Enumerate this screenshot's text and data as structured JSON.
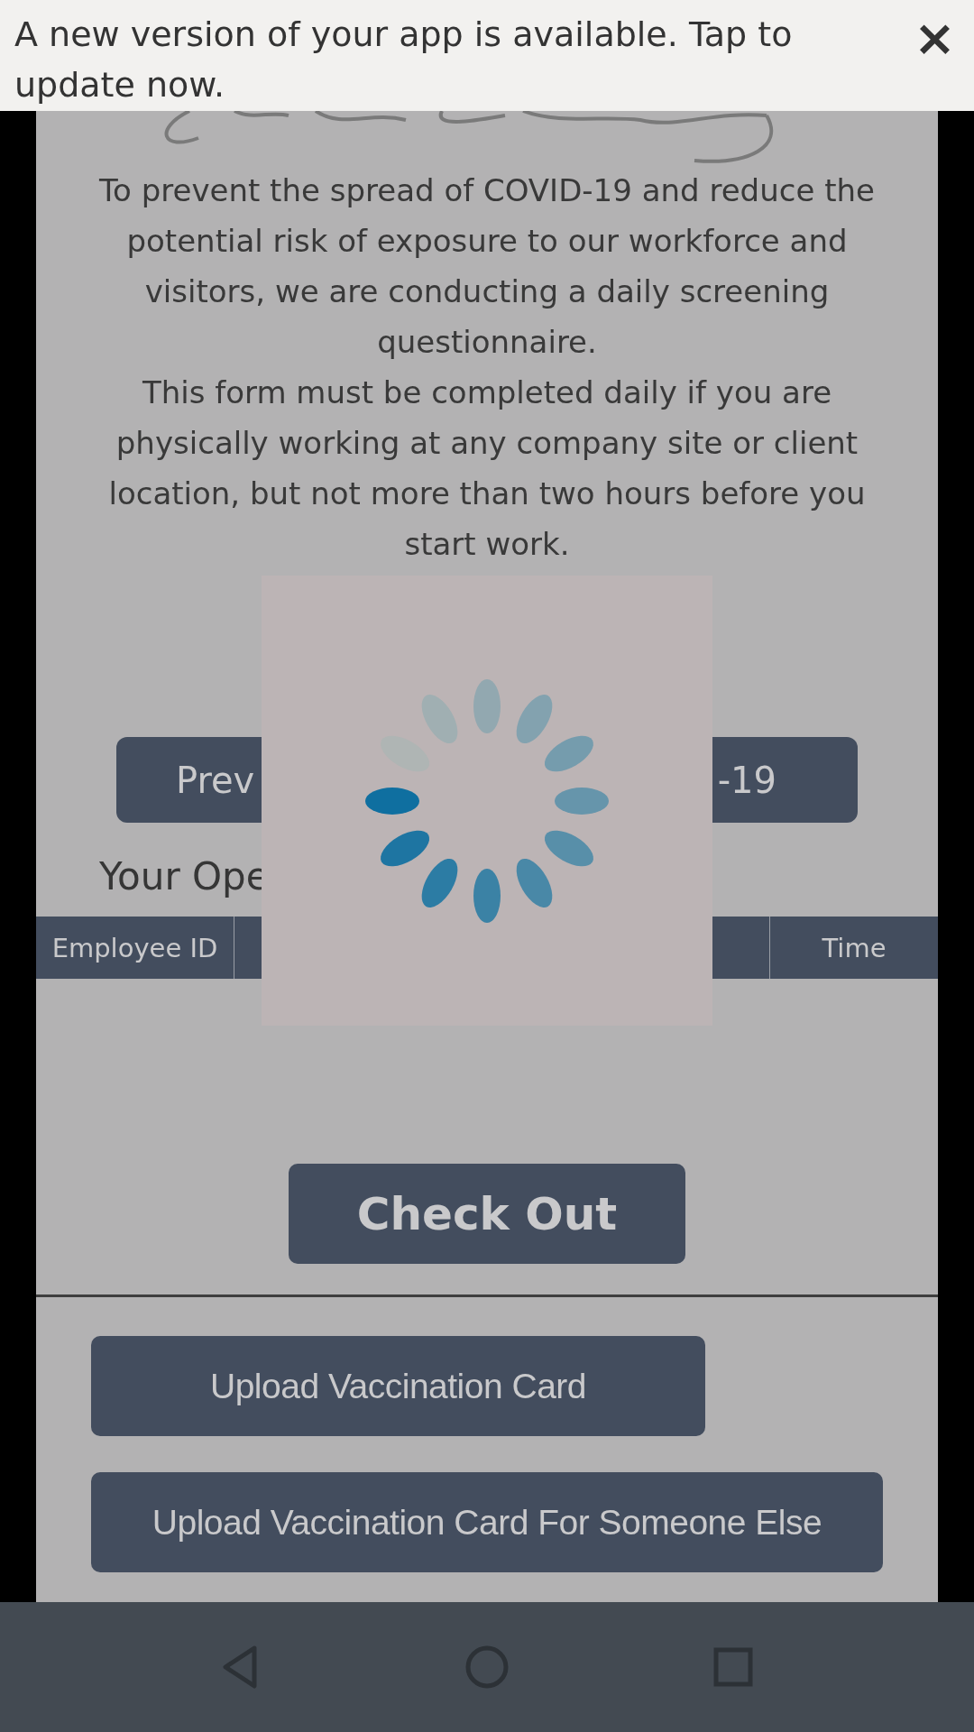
{
  "banner": {
    "message": "A new version of your app is available. Tap to update now.",
    "close": "×"
  },
  "intro": [
    "To prevent the spread of COVID-19 and reduce the potential risk of exposure to our workforce and visitors, we are conducting a daily screening questionnaire.",
    "This form must be completed daily if you are physically working at any company site or client location, but not more than two hours before you start work."
  ],
  "covid_button": {
    "left_text": "Prev",
    "right_text": "-19"
  },
  "section_title": "Your Ope",
  "table": {
    "columns": [
      {
        "label": "Employee ID"
      },
      {
        "label": "Time"
      }
    ]
  },
  "check_out": "Check Out",
  "uploads": [
    {
      "label": "Upload Vaccination Card",
      "kind": "short"
    },
    {
      "label": "Upload Vaccination Card For Someone Else",
      "kind": "wide"
    }
  ],
  "loading": {
    "kind": "spinner"
  }
}
